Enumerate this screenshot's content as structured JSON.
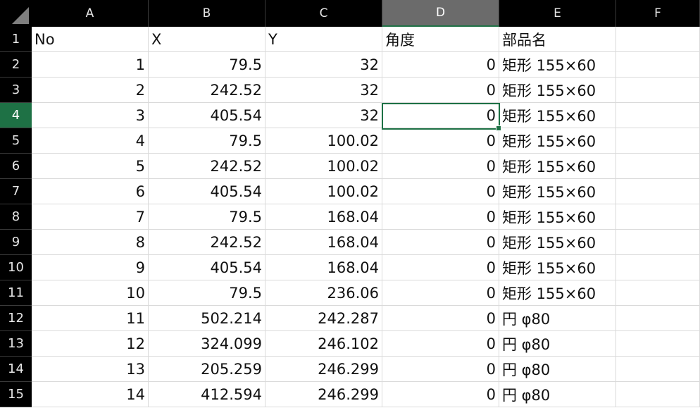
{
  "column_headers": [
    "A",
    "B",
    "C",
    "D",
    "E",
    "F"
  ],
  "row_headers": [
    "1",
    "2",
    "3",
    "4",
    "5",
    "6",
    "7",
    "8",
    "9",
    "10",
    "11",
    "12",
    "13",
    "14",
    "15"
  ],
  "active_cell": "D4",
  "header_row": [
    "No",
    "X",
    "Y",
    "角度",
    "部品名",
    ""
  ],
  "rows": [
    [
      "1",
      "79.5",
      "32",
      "0",
      "矩形 155×60",
      ""
    ],
    [
      "2",
      "242.52",
      "32",
      "0",
      "矩形 155×60",
      ""
    ],
    [
      "3",
      "405.54",
      "32",
      "0",
      "矩形 155×60",
      ""
    ],
    [
      "4",
      "79.5",
      "100.02",
      "0",
      "矩形 155×60",
      ""
    ],
    [
      "5",
      "242.52",
      "100.02",
      "0",
      "矩形 155×60",
      ""
    ],
    [
      "6",
      "405.54",
      "100.02",
      "0",
      "矩形 155×60",
      ""
    ],
    [
      "7",
      "79.5",
      "168.04",
      "0",
      "矩形 155×60",
      ""
    ],
    [
      "8",
      "242.52",
      "168.04",
      "0",
      "矩形 155×60",
      ""
    ],
    [
      "9",
      "405.54",
      "168.04",
      "0",
      "矩形 155×60",
      ""
    ],
    [
      "10",
      "79.5",
      "236.06",
      "0",
      "矩形 155×60",
      ""
    ],
    [
      "11",
      "502.214",
      "242.287",
      "0",
      "円 φ80",
      ""
    ],
    [
      "12",
      "324.099",
      "246.102",
      "0",
      "円 φ80",
      ""
    ],
    [
      "13",
      "205.259",
      "246.299",
      "0",
      "円 φ80",
      ""
    ],
    [
      "14",
      "412.594",
      "246.299",
      "0",
      "円 φ80",
      ""
    ]
  ],
  "colors": {
    "header_bg": "#000000",
    "active_header_bg": "#6b6b6b",
    "accent_green": "#1e7145",
    "gridline": "#dadada"
  }
}
